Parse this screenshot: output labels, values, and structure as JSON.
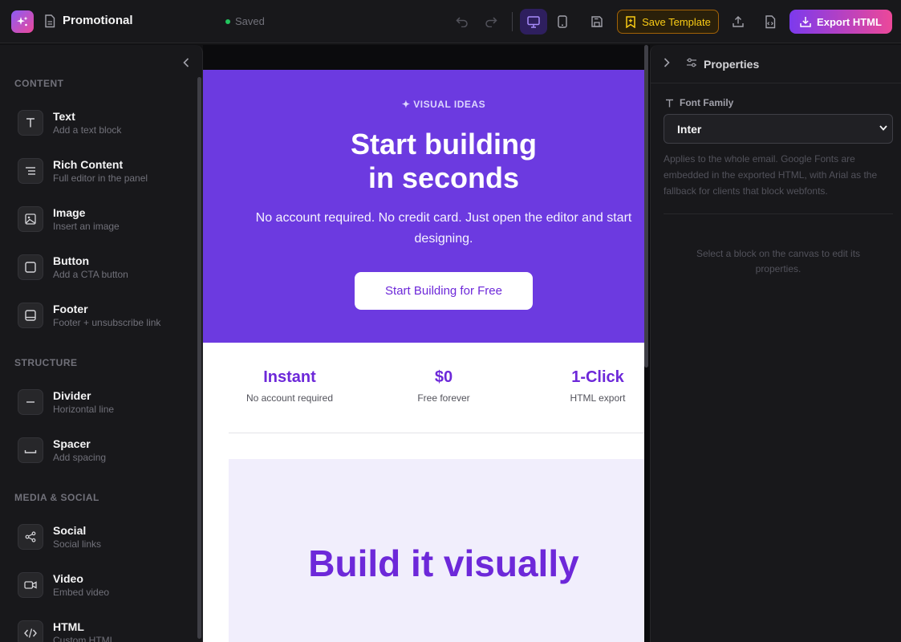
{
  "header": {
    "document_title": "Promotional",
    "save_status": "Saved",
    "save_template_label": "Save Template",
    "export_label": "Export HTML"
  },
  "sidebar": {
    "sections": [
      {
        "title": "CONTENT"
      },
      {
        "title": "STRUCTURE"
      },
      {
        "title": "MEDIA & SOCIAL"
      }
    ],
    "blocks": [
      {
        "label": "Text",
        "description": "Add a text block",
        "icon": "text-t-icon"
      },
      {
        "label": "Rich Content",
        "description": "Full editor in the panel",
        "icon": "list-icon"
      },
      {
        "label": "Image",
        "description": "Insert an image",
        "icon": "image-icon"
      },
      {
        "label": "Button",
        "description": "Add a CTA button",
        "icon": "square-icon"
      },
      {
        "label": "Footer",
        "description": "Footer + unsubscribe link",
        "icon": "footer-icon"
      },
      {
        "label": "Divider",
        "description": "Horizontal line",
        "icon": "minus-icon"
      },
      {
        "label": "Spacer",
        "description": "Add spacing",
        "icon": "spacer-icon"
      },
      {
        "label": "Social",
        "description": "Social links",
        "icon": "share-icon"
      },
      {
        "label": "Video",
        "description": "Embed video",
        "icon": "video-icon"
      },
      {
        "label": "HTML",
        "description": "Custom HTML",
        "icon": "code-icon"
      }
    ]
  },
  "email": {
    "eyebrow": "✦ VISUAL IDEAS",
    "hero_title_line1": "Start building",
    "hero_title_line2": "in seconds",
    "hero_subtitle": "No account required. No credit card. Just open the editor and start designing.",
    "hero_cta": "Start Building for Free",
    "stats": [
      {
        "value": "Instant",
        "label": "No account required"
      },
      {
        "value": "$0",
        "label": "Free forever"
      },
      {
        "value": "1-Click",
        "label": "HTML export"
      }
    ],
    "build_title": "Build it visually"
  },
  "properties": {
    "title": "Properties",
    "font_family_label": "Font Family",
    "font_family_value": "Inter",
    "font_help": "Applies to the whole email. Google Fonts are embedded in the exported HTML, with Arial as the fallback for clients that block webfonts.",
    "empty_state": "Select a block on the canvas to edit its properties."
  },
  "colors": {
    "accent": "#6c3ae0",
    "save_template": "#facc15",
    "saved_dot": "#22c55e"
  }
}
